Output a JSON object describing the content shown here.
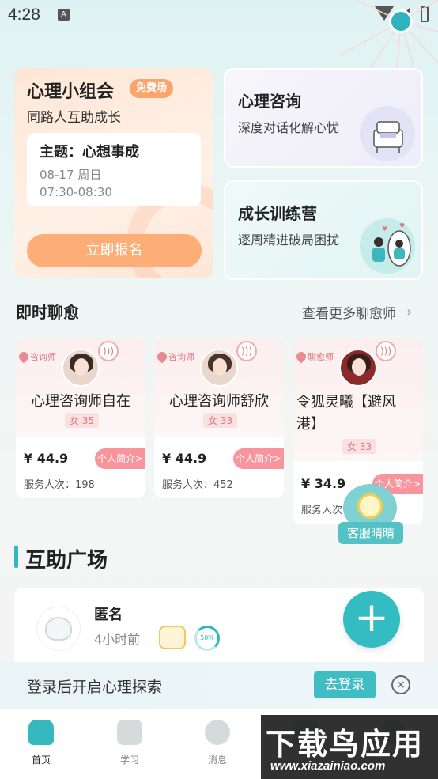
{
  "status_bar": {
    "time": "4:28",
    "a_icon": "A"
  },
  "group_card": {
    "title": "心理小组会",
    "badge": "免费场",
    "subtitle": "同路人互助成长",
    "theme": "主题：心想事成",
    "date": "08-17 周日",
    "time_range": "07:30-08:30",
    "signup_label": "立即报名"
  },
  "consult_card": {
    "title": "心理咨询",
    "subtitle": "深度对话化解心忧",
    "icon": "armchair-illustration"
  },
  "growth_card": {
    "title": "成长训练营",
    "subtitle": "逐周精进破局困扰",
    "icon": "mirror-people-illustration"
  },
  "chat_section": {
    "title": "即时聊愈",
    "more_label": "查看更多聊愈师",
    "counselors": [
      {
        "tag": "咨询师",
        "name": "心理咨询师自在",
        "gender_age": "女 35",
        "price": "¥ 44.9",
        "intro_label": "个人简介>",
        "served": "服务人次：198"
      },
      {
        "tag": "咨询师",
        "name": "心理咨询师舒欣",
        "gender_age": "女 33",
        "price": "¥ 44.9",
        "intro_label": "个人简介>",
        "served": "服务人次：452"
      },
      {
        "tag": "聊愈师",
        "name": "令狐灵曦【避风港】",
        "gender_age": "女 33",
        "price": "¥ 34.9",
        "intro_label": "个人简介>",
        "served": "服务人次"
      }
    ]
  },
  "service_float": {
    "label": "客服晴晴"
  },
  "help_section": {
    "title": "互助广场",
    "post": {
      "name": "匿名",
      "time": "4小时前",
      "progress": "50%"
    },
    "fab_label": "+"
  },
  "login_banner": {
    "text": "登录后开启心理探索",
    "button": "去登录",
    "close": "×"
  },
  "tabbar": {
    "tabs": [
      {
        "label": "首页"
      },
      {
        "label": "学习"
      },
      {
        "label": "消息"
      },
      {
        "label": ""
      },
      {
        "label": ""
      }
    ]
  },
  "watermark": {
    "big": "下载鸟应用",
    "small": "www.xiazainiao.com"
  }
}
